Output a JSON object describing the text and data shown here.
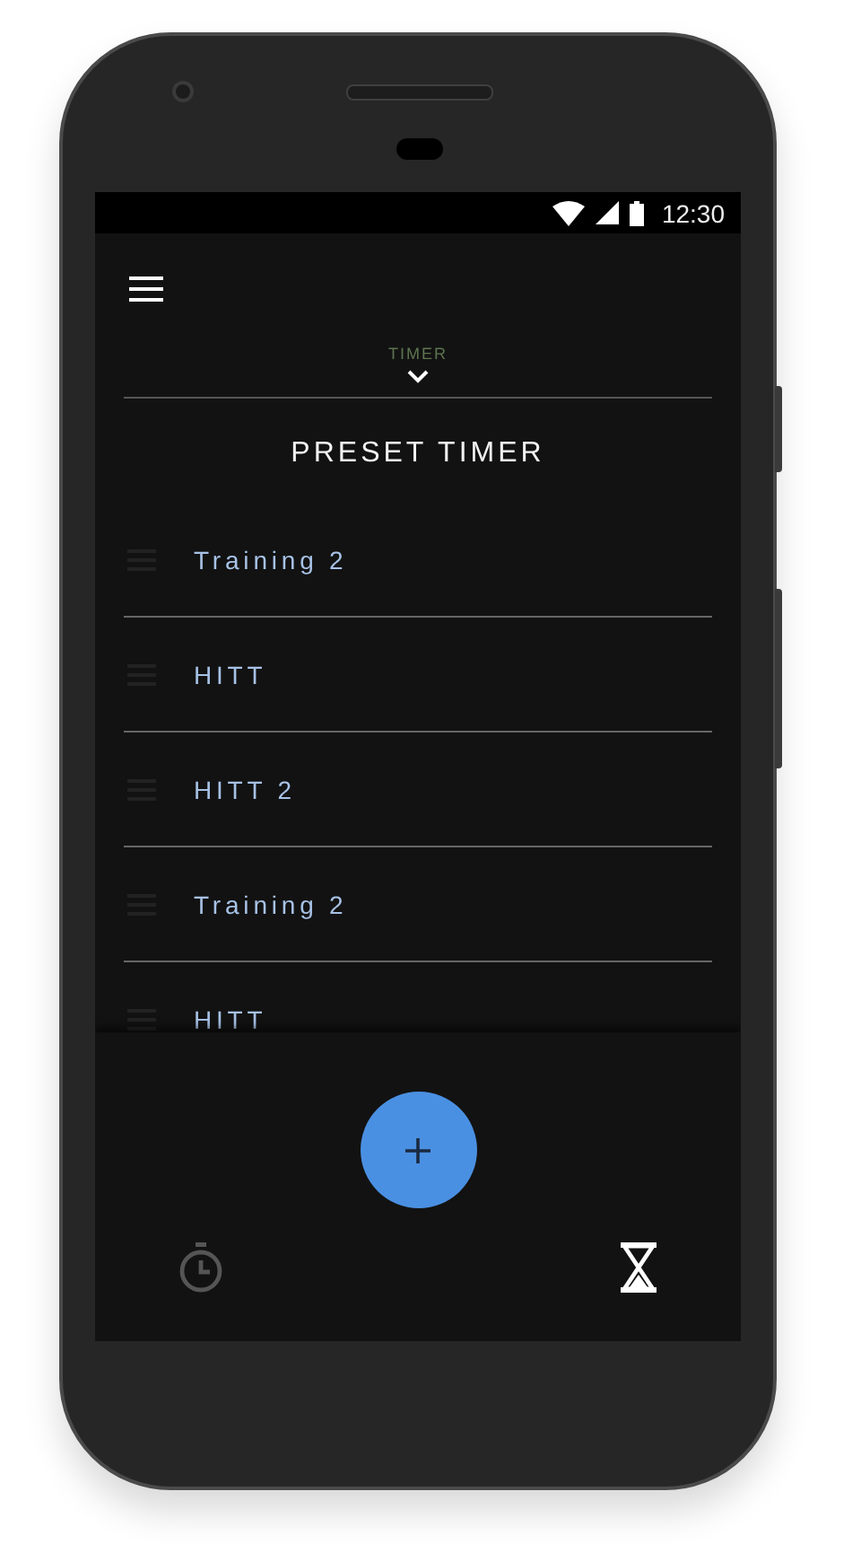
{
  "status_bar": {
    "time": "12:30"
  },
  "header": {
    "section_label": "TIMER"
  },
  "title": "PRESET TIMER",
  "presets": [
    {
      "name": "Training 2"
    },
    {
      "name": "HITT"
    },
    {
      "name": "HITT 2"
    },
    {
      "name": "Training 2"
    },
    {
      "name": "HITT"
    }
  ],
  "bottom_nav": [
    {
      "kind": "stopwatch",
      "selected": false
    },
    {
      "kind": "hourglass",
      "selected": true
    }
  ]
}
